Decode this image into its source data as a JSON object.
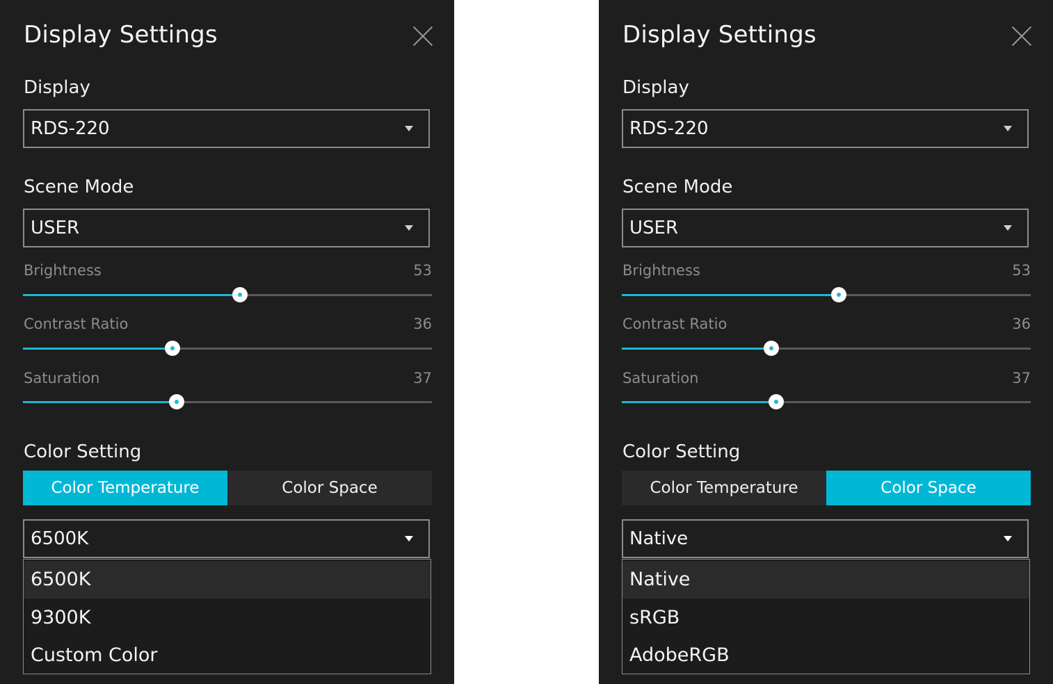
{
  "panels": [
    {
      "title": "Display Settings",
      "display_label": "Display",
      "display_value": "RDS-220",
      "scene_label": "Scene Mode",
      "scene_value": "USER",
      "sliders": [
        {
          "label": "Brightness",
          "value": "53",
          "fraction": 0.53
        },
        {
          "label": "Contrast Ratio",
          "value": "36",
          "fraction": 0.366
        },
        {
          "label": "Saturation",
          "value": "37",
          "fraction": 0.375
        }
      ],
      "color_setting_label": "Color Setting",
      "tabs": [
        "Color Temperature",
        "Color Space"
      ],
      "active_tab": 0,
      "color_value": "6500K",
      "options": [
        "6500K",
        "9300K",
        "Custom Color"
      ],
      "selected_option": 0
    },
    {
      "title": "Display Settings",
      "display_label": "Display",
      "display_value": "RDS-220",
      "scene_label": "Scene Mode",
      "scene_value": "USER",
      "sliders": [
        {
          "label": "Brightness",
          "value": "53",
          "fraction": 0.53
        },
        {
          "label": "Contrast Ratio",
          "value": "36",
          "fraction": 0.366
        },
        {
          "label": "Saturation",
          "value": "37",
          "fraction": 0.377
        }
      ],
      "color_setting_label": "Color Setting",
      "tabs": [
        "Color Temperature",
        "Color Space"
      ],
      "active_tab": 1,
      "color_value": "Native",
      "options": [
        "Native",
        "sRGB",
        "AdobeRGB"
      ],
      "selected_option": 0
    }
  ],
  "colors": {
    "panel_bg": "#1e1e1e",
    "accent": "#00b8d6",
    "slider_fill": "#1cb8d4",
    "muted_text": "#8d8d8d"
  }
}
